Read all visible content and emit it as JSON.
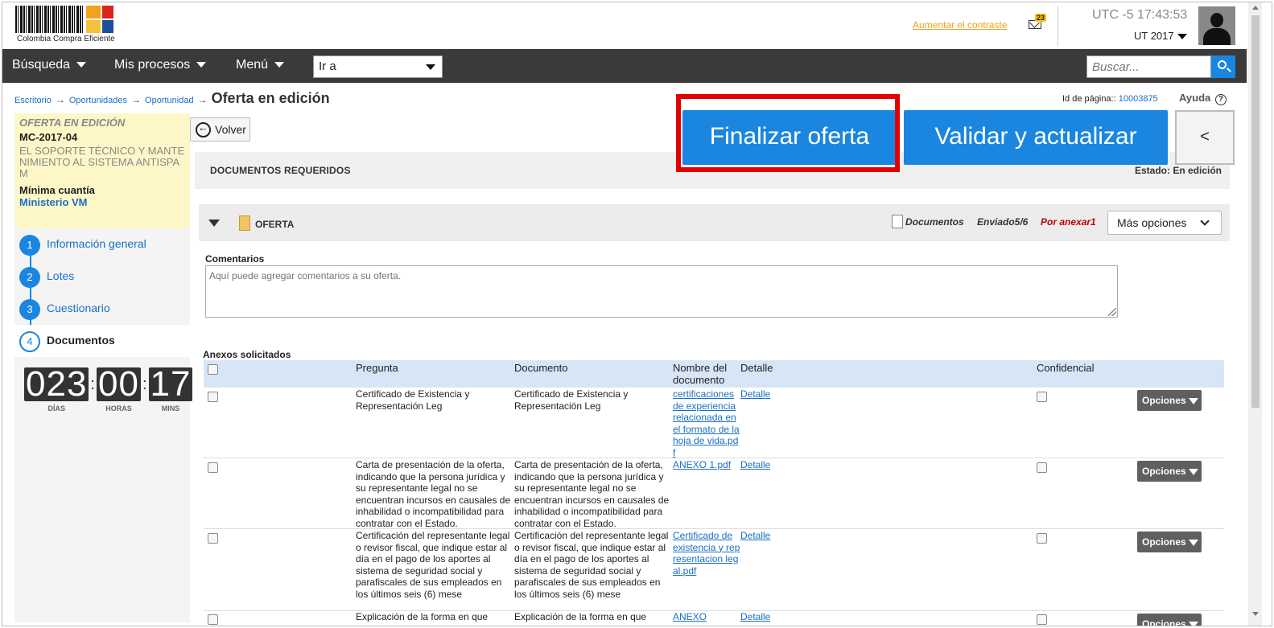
{
  "header": {
    "logo_text": "Colombia Compra Eficiente",
    "contrast_link": "Aumentar el contraste",
    "mail_count": "23",
    "clock": "UTC -5 17:43:53",
    "org": "UT 2017"
  },
  "nav": {
    "items": [
      "Búsqueda",
      "Mis procesos",
      "Menú"
    ],
    "goto_value": "Ir a",
    "search_placeholder": "Buscar..."
  },
  "breadcrumb": {
    "items": [
      "Escritorio",
      "Oportunidades",
      "Oportunidad"
    ],
    "current": "Oferta en edición",
    "arrow": "→"
  },
  "page_meta": {
    "page_id_label": "Id de página::",
    "page_id_value": "10003875",
    "help_label": "Ayuda",
    "help_glyph": "?"
  },
  "left_panel": {
    "state": "OFERTA EN EDICIÓN",
    "code": "MC-2017-04",
    "title": "EL SOPORTE TÉCNICO Y MANTENIMIENTO AL SISTEMA ANTISPAM",
    "modality": "Mínima cuantía",
    "entity": "Ministerio VM",
    "steps": [
      {
        "num": "1",
        "label": "Información general"
      },
      {
        "num": "2",
        "label": "Lotes"
      },
      {
        "num": "3",
        "label": "Cuestionario"
      },
      {
        "num": "4",
        "label": "Documentos"
      }
    ],
    "countdown": {
      "days": "023",
      "hours": "00",
      "mins": "17",
      "sep": ":",
      "days_label": "DÍAS",
      "hours_label": "HORAS",
      "mins_label": "MINS"
    }
  },
  "actions": {
    "back": "Volver",
    "finalize": "Finalizar oferta",
    "validate": "Validar y actualizar",
    "collapse": "<"
  },
  "documents": {
    "header_title": "DOCUMENTOS REQUERIDOS",
    "state_text": "Estado:   En edición",
    "section_label": "OFERTA",
    "docs_label": "Documentos",
    "sent": "Enviado5/6",
    "pending": "Por anexar1",
    "more_options": "Más opciones",
    "comments_label": "Comentarios",
    "comments_placeholder": "Aquí puede agregar comentarios a su oferta.",
    "annex_title": "Anexos solicitados",
    "columns": {
      "question": "Pregunta",
      "document": "Documento",
      "name": "Nombre del documento",
      "detail": "Detalle",
      "confidential": "Confidencial"
    },
    "rows": [
      {
        "question": "Certificado de Existencia y Representación Leg",
        "document": "Certificado de Existencia y Representación Leg",
        "name": "certificaciones de experiencia relacionada en el formato de la hoja de vida.pdf",
        "detail": "Detalle",
        "options": "Opciones"
      },
      {
        "question": "Carta de presentación de la oferta, indicando que la persona jurídica y su representante legal no se encuentran incursos en causales de inhabilidad o incompatibilidad para contratar con el Estado.",
        "document": "Carta de presentación de la oferta, indicando que la persona jurídica y su representante legal no se encuentran incursos en causales de inhabilidad o incompatibilidad para contratar con el Estado.",
        "name": "ANEXO 1.pdf",
        "detail": "Detalle",
        "options": "Opciones"
      },
      {
        "question": "Certificación del representante legal o revisor fiscal, que indique estar al día en el pago de los aportes al sistema de seguridad social y parafiscales de sus empleados en los últimos seis (6) mese",
        "document": "Certificación del representante legal o revisor fiscal, que indique estar al día en el pago de los aportes al sistema de seguridad social y parafiscales de sus empleados en los últimos seis (6) mese",
        "name": "Certificado de existencia y representacion legal.pdf",
        "detail": "Detalle",
        "options": "Opciones"
      },
      {
        "question": "Explicación de la forma en que",
        "document": "Explicación de la forma en que",
        "name": "ANEXO",
        "detail": "Detalle",
        "options": "Opciones"
      }
    ]
  }
}
